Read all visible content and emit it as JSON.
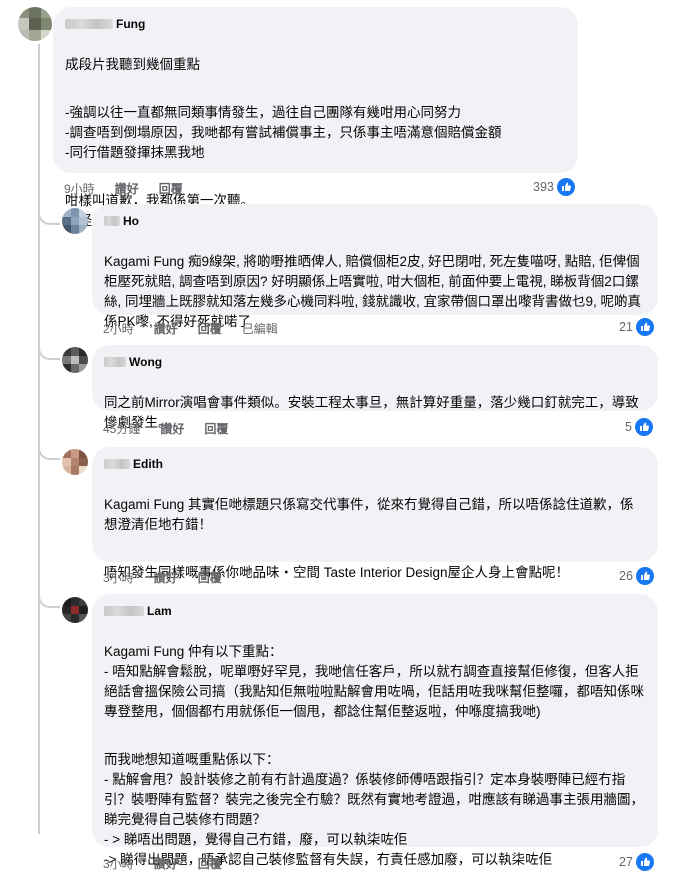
{
  "colors": {
    "like_blue": "#1877f2",
    "bubble_bg": "#f0f2f5",
    "meta_gray": "#65676b"
  },
  "comments": [
    {
      "name": "Fung",
      "paragraphs": [
        "成段片我聽到幾個重點",
        "-強調以往一直都無同類事情發生，過往自己團隊有幾咁用心同努力\n-調查唔到倒塌原因，我哋都有嘗試補償事主，只係事主唔滿意個賠償金額\n-同行借題發揮抹黑我地",
        "咁樣叫道歉，我都係第一次聽。\n唔怪之得事前要寫稿準備咁耐啦"
      ],
      "time": "9小時",
      "like": "讚好",
      "reply": "回覆",
      "edited": "",
      "reactions": "393"
    },
    {
      "name": "Ho",
      "paragraphs": [
        "Kagami Fung 痴9線架, 將啲嘢推晒俾人, 賠償個柜2皮, 好巴閉咁, 死左隻喵呀, 點賠, 佢俾個柜壓死就賠, 調查唔到原因? 好明顯係上唔實啦, 咁大個柜, 前面仲要上電視, 睇板背個2口鏍絲, 同埋牆上既膠就知落左幾多心機同料啦, 錢就識收, 宜家帶個口罩出嚟背書做乜9, 呢啲真係PK嚟, 不得好死就喏了"
      ],
      "time": "2小時",
      "like": "讚好",
      "reply": "回覆",
      "edited": "已編輯",
      "reactions": "21"
    },
    {
      "name": "Wong",
      "paragraphs": [
        "同之前Mirror演唱會事件類似。安裝工程太事旦，無計算好重量，落少幾口釘就完工，導致慘劇發生。"
      ],
      "time": "45分鐘",
      "like": "讚好",
      "reply": "回覆",
      "edited": "",
      "reactions": "5"
    },
    {
      "name": "Edith",
      "paragraphs": [
        "Kagami Fung 其實佢哋標題只係寫交代事件，從來冇覺得自己錯，所以唔係諗住道歉，係想澄清佢地冇錯！",
        "唔知發生同樣嘅事係你哋品味・空間 Taste Interior Design屋企人身上會點呢！"
      ],
      "time": "3小時",
      "like": "讚好",
      "reply": "回覆",
      "edited": "",
      "reactions": "26"
    },
    {
      "name": "Lam",
      "paragraphs": [
        "Kagami Fung 仲有以下重點：\n- 唔知點解會鬆脫，呢單嘢好罕見，我哋信任客戶，所以就冇調查直接幫佢修復，但客人拒絕話會搵保險公司搞（我點知佢無啦啦點解會用咗喎，佢話用咗我咪幫佢整囉，都唔知係咪專登整甩，個個都冇用就係佢一個甩，都諗住幫佢整返啦，仲喺度搞我哋)",
        "而我哋想知道嘅重點係以下：\n- 點解會甩？設計裝修之前有冇計過度過？係裝修師傅唔跟指引？定本身裝嘢陣已經冇指引？裝嘢陣有監督？裝完之後完全冇驗？既然有實地考證過，咁應該有睇過事主張用牆圖，睇完覺得自己裝修冇問題？\n- > 睇唔出問題，覺得自己冇錯，廢，可以執柒咗佢\n-> 睇得出問題，唔承認自己裝修監督有失誤，冇責任感加廢，可以執柒咗佢"
      ],
      "time": "3小時",
      "like": "讚好",
      "reply": "回覆",
      "edited": "",
      "reactions": "27"
    }
  ]
}
